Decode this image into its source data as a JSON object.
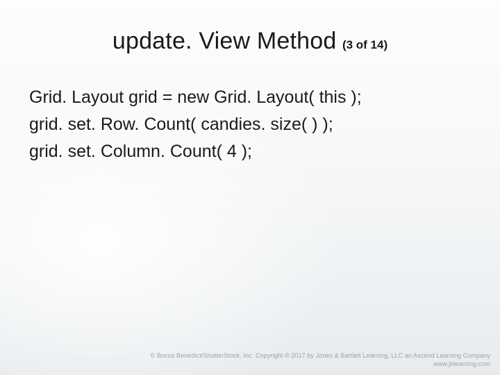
{
  "slide": {
    "title": "update. View Method",
    "counter": "(3 of 14)",
    "code_lines": [
      "Grid. Layout grid = new Grid. Layout( this );",
      "grid. set. Row. Count( candies. size( ) );",
      "grid. set. Column. Count( 4 );"
    ]
  },
  "footer": {
    "copyright": "© Bocos Benedict/ShutterStock, Inc. Copyright © 2017 by Jones & Bartlett Learning, LLC an Ascend Learning Company",
    "url": "www.jblearning.com"
  }
}
